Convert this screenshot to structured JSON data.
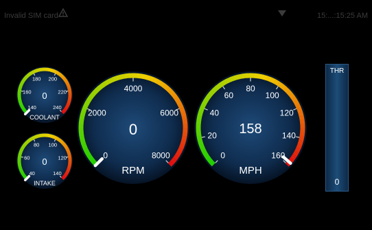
{
  "status_bar": {
    "sim_text": "Invalid SIM card",
    "right_text": "15:...:15:25 AM",
    "warning_icon": "warning-triangle-icon",
    "wifi_icon": "wifi-icon"
  },
  "gauges": {
    "coolant": {
      "label": "COOLANT",
      "value": "0",
      "ticks": [
        "140",
        "160",
        "180",
        "200",
        "220",
        "240"
      ],
      "needle_value": 140
    },
    "intake": {
      "label": "INTAKE",
      "value": "0",
      "ticks": [
        "40",
        "60",
        "80",
        "100",
        "120",
        "140"
      ],
      "needle_value": 40
    },
    "rpm": {
      "label": "RPM",
      "value": "0",
      "ticks": [
        "0",
        "2000",
        "4000",
        "6000",
        "8000"
      ],
      "needle_value": 0
    },
    "mph": {
      "label": "MPH",
      "value": "158",
      "ticks": [
        "0",
        "20",
        "40",
        "60",
        "80",
        "100",
        "120",
        "140",
        "160"
      ],
      "needle_value": 158
    }
  },
  "throttle": {
    "label": "THR",
    "value": "0"
  },
  "colors": {
    "green": "#22d000",
    "yellow": "#f0d000",
    "red": "#e01010",
    "dial_inner": "#1e4a78",
    "dial_outer": "#061426"
  }
}
